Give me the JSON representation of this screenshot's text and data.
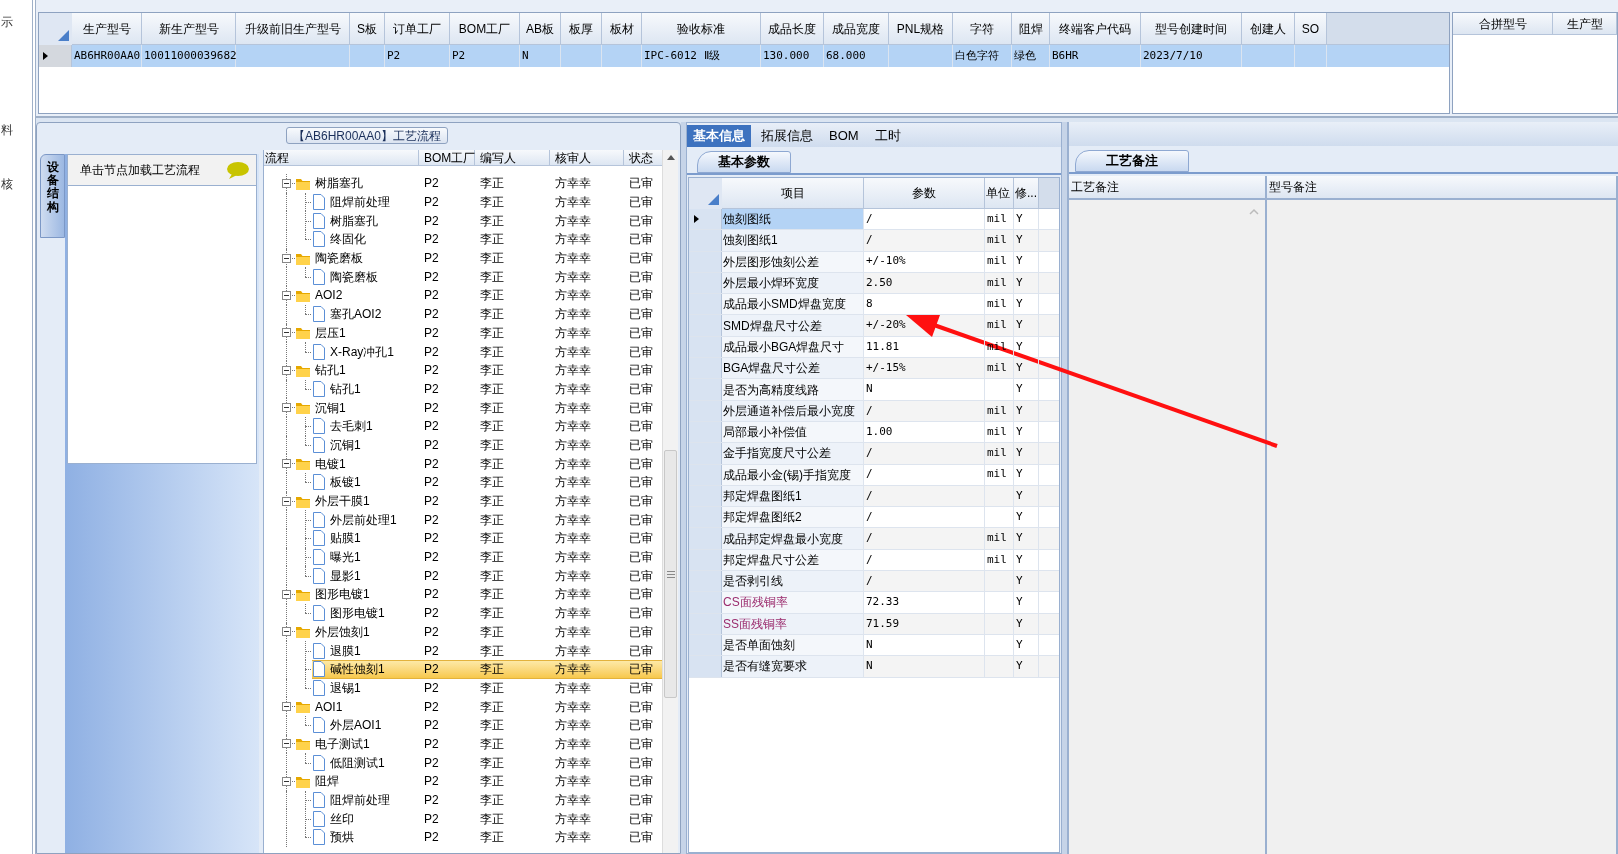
{
  "side_labels": [
    "示",
    "料",
    "核"
  ],
  "top_grid": {
    "columns": [
      "生产型号",
      "新生产型号",
      "升级前旧生产型号",
      "S板",
      "订单工厂",
      "BOM工厂",
      "AB板",
      "板厚",
      "板材",
      "验收标准",
      "成品长度",
      "成品宽度",
      "PNL规格",
      "字符",
      "阻焊",
      "终端客户代码",
      "型号创建时间",
      "创建人",
      "SO"
    ],
    "rows": [
      {
        "selected": true,
        "cells": [
          "AB6HR00AA0",
          "10011000039682",
          null,
          null,
          "P2",
          "P2",
          "N",
          null,
          null,
          "IPC-6012 Ⅱ级",
          "130.000",
          "68.000",
          null,
          "白色字符",
          "绿色",
          "B6HR",
          "2023/7/10",
          null,
          null
        ]
      }
    ]
  },
  "merge_grid": {
    "columns": [
      "合拼型号",
      "生产型"
    ]
  },
  "process_box": {
    "title": "【AB6HR00AA0】工艺流程",
    "side_tab": "设备结构",
    "hint": "单击节点加载工艺流程",
    "tree": {
      "columns": [
        "流程",
        "BOM工厂",
        "编写人",
        "核审人",
        "状态"
      ],
      "nodes": [
        {
          "label": "树脂塞孔",
          "bom": "P2",
          "writer": "李正",
          "reviewer": "方幸幸",
          "status": "已审",
          "expanded": true,
          "selected": false,
          "children": [
            {
              "label": "阻焊前处理",
              "bom": "P2",
              "writer": "李正",
              "reviewer": "方幸幸",
              "status": "已审",
              "selected": false
            },
            {
              "label": "树脂塞孔",
              "bom": "P2",
              "writer": "李正",
              "reviewer": "方幸幸",
              "status": "已审",
              "selected": false
            },
            {
              "label": "终固化",
              "bom": "P2",
              "writer": "李正",
              "reviewer": "方幸幸",
              "status": "已审",
              "selected": false
            }
          ]
        },
        {
          "label": "陶瓷磨板",
          "bom": "P2",
          "writer": "李正",
          "reviewer": "方幸幸",
          "status": "已审",
          "expanded": true,
          "selected": false,
          "children": [
            {
              "label": "陶瓷磨板",
              "bom": "P2",
              "writer": "李正",
              "reviewer": "方幸幸",
              "status": "已审",
              "selected": false
            }
          ]
        },
        {
          "label": "AOI2",
          "bom": "P2",
          "writer": "李正",
          "reviewer": "方幸幸",
          "status": "已审",
          "expanded": true,
          "selected": false,
          "children": [
            {
              "label": "塞孔AOI2",
              "bom": "P2",
              "writer": "李正",
              "reviewer": "方幸幸",
              "status": "已审",
              "selected": false
            }
          ]
        },
        {
          "label": "层压1",
          "bom": "P2",
          "writer": "李正",
          "reviewer": "方幸幸",
          "status": "已审",
          "expanded": true,
          "selected": false,
          "children": [
            {
              "label": "X-Ray冲孔1",
              "bom": "P2",
              "writer": "李正",
              "reviewer": "方幸幸",
              "status": "已审",
              "selected": false
            }
          ]
        },
        {
          "label": "钻孔1",
          "bom": "P2",
          "writer": "李正",
          "reviewer": "方幸幸",
          "status": "已审",
          "expanded": true,
          "selected": false,
          "children": [
            {
              "label": "钻孔1",
              "bom": "P2",
              "writer": "李正",
              "reviewer": "方幸幸",
              "status": "已审",
              "selected": false
            }
          ]
        },
        {
          "label": "沉铜1",
          "bom": "P2",
          "writer": "李正",
          "reviewer": "方幸幸",
          "status": "已审",
          "expanded": true,
          "selected": false,
          "children": [
            {
              "label": "去毛刺1",
              "bom": "P2",
              "writer": "李正",
              "reviewer": "方幸幸",
              "status": "已审",
              "selected": false
            },
            {
              "label": "沉铜1",
              "bom": "P2",
              "writer": "李正",
              "reviewer": "方幸幸",
              "status": "已审",
              "selected": false
            }
          ]
        },
        {
          "label": "电镀1",
          "bom": "P2",
          "writer": "李正",
          "reviewer": "方幸幸",
          "status": "已审",
          "expanded": true,
          "selected": false,
          "children": [
            {
              "label": "板镀1",
              "bom": "P2",
              "writer": "李正",
              "reviewer": "方幸幸",
              "status": "已审",
              "selected": false
            }
          ]
        },
        {
          "label": "外层干膜1",
          "bom": "P2",
          "writer": "李正",
          "reviewer": "方幸幸",
          "status": "已审",
          "expanded": true,
          "selected": false,
          "children": [
            {
              "label": "外层前处理1",
              "bom": "P2",
              "writer": "李正",
              "reviewer": "方幸幸",
              "status": "已审",
              "selected": false
            },
            {
              "label": "贴膜1",
              "bom": "P2",
              "writer": "李正",
              "reviewer": "方幸幸",
              "status": "已审",
              "selected": false
            },
            {
              "label": "曝光1",
              "bom": "P2",
              "writer": "李正",
              "reviewer": "方幸幸",
              "status": "已审",
              "selected": false
            },
            {
              "label": "显影1",
              "bom": "P2",
              "writer": "李正",
              "reviewer": "方幸幸",
              "status": "已审",
              "selected": false
            }
          ]
        },
        {
          "label": "图形电镀1",
          "bom": "P2",
          "writer": "李正",
          "reviewer": "方幸幸",
          "status": "已审",
          "expanded": true,
          "selected": false,
          "children": [
            {
              "label": "图形电镀1",
              "bom": "P2",
              "writer": "李正",
              "reviewer": "方幸幸",
              "status": "已审",
              "selected": false
            }
          ]
        },
        {
          "label": "外层蚀刻1",
          "bom": "P2",
          "writer": "李正",
          "reviewer": "方幸幸",
          "status": "已审",
          "expanded": true,
          "selected": false,
          "children": [
            {
              "label": "退膜1",
              "bom": "P2",
              "writer": "李正",
              "reviewer": "方幸幸",
              "status": "已审",
              "selected": false
            },
            {
              "label": "碱性蚀刻1",
              "bom": "P2",
              "writer": "李正",
              "reviewer": "方幸幸",
              "status": "已审",
              "selected": true
            },
            {
              "label": "退锡1",
              "bom": "P2",
              "writer": "李正",
              "reviewer": "方幸幸",
              "status": "已审",
              "selected": false
            }
          ]
        },
        {
          "label": "AOI1",
          "bom": "P2",
          "writer": "李正",
          "reviewer": "方幸幸",
          "status": "已审",
          "expanded": true,
          "selected": false,
          "children": [
            {
              "label": "外层AOI1",
              "bom": "P2",
              "writer": "李正",
              "reviewer": "方幸幸",
              "status": "已审",
              "selected": false
            }
          ]
        },
        {
          "label": "电子测试1",
          "bom": "P2",
          "writer": "李正",
          "reviewer": "方幸幸",
          "status": "已审",
          "expanded": true,
          "selected": false,
          "children": [
            {
              "label": "低阻测试1",
              "bom": "P2",
              "writer": "李正",
              "reviewer": "方幸幸",
              "status": "已审",
              "selected": false
            }
          ]
        },
        {
          "label": "阻焊",
          "bom": "P2",
          "writer": "李正",
          "reviewer": "方幸幸",
          "status": "已审",
          "expanded": true,
          "selected": false,
          "children": [
            {
              "label": "阻焊前处理",
              "bom": "P2",
              "writer": "李正",
              "reviewer": "方幸幸",
              "status": "已审",
              "selected": false
            },
            {
              "label": "丝印",
              "bom": "P2",
              "writer": "李正",
              "reviewer": "方幸幸",
              "status": "已审",
              "selected": false
            },
            {
              "label": "预烘",
              "bom": "P2",
              "writer": "李正",
              "reviewer": "方幸幸",
              "status": "已审",
              "selected": false
            }
          ]
        }
      ]
    }
  },
  "info_panel": {
    "tabs": [
      {
        "label": "基本信息",
        "selected": true
      },
      {
        "label": "拓展信息",
        "selected": false
      },
      {
        "label": "BOM",
        "selected": false
      },
      {
        "label": "工时",
        "selected": false
      }
    ],
    "subtab": "基本参数",
    "columns": [
      "项目",
      "参数",
      "单位",
      "修..."
    ],
    "rows": [
      {
        "item": "蚀刻图纸",
        "value": "/",
        "unit": "mil",
        "flag": "Y",
        "highlighted": false,
        "selected": true
      },
      {
        "item": "蚀刻图纸1",
        "value": "/",
        "unit": "mil",
        "flag": "Y",
        "highlighted": false,
        "selected": false
      },
      {
        "item": "外层图形蚀刻公差",
        "value": "+/-10%",
        "unit": "mil",
        "flag": "Y",
        "highlighted": false,
        "selected": false
      },
      {
        "item": "外层最小焊环宽度",
        "value": "2.50",
        "unit": "mil",
        "flag": "Y",
        "highlighted": false,
        "selected": false
      },
      {
        "item": "成品最小SMD焊盘宽度",
        "value": "8",
        "unit": "mil",
        "flag": "Y",
        "highlighted": false,
        "selected": false
      },
      {
        "item": "SMD焊盘尺寸公差",
        "value": "+/-20%",
        "unit": "mil",
        "flag": "Y",
        "highlighted": false,
        "selected": false
      },
      {
        "item": "成品最小BGA焊盘尺寸",
        "value": "11.81",
        "unit": "mil",
        "flag": "Y",
        "highlighted": false,
        "selected": false
      },
      {
        "item": "BGA焊盘尺寸公差",
        "value": "+/-15%",
        "unit": "mil",
        "flag": "Y",
        "highlighted": false,
        "selected": false
      },
      {
        "item": "是否为高精度线路",
        "value": "N",
        "flag": "Y",
        "highlighted": false,
        "selected": false
      },
      {
        "item": "外层通道补偿后最小宽度",
        "value": "/",
        "unit": "mil",
        "flag": "Y",
        "highlighted": false,
        "selected": false
      },
      {
        "item": "局部最小补偿值",
        "value": "1.00",
        "unit": "mil",
        "flag": "Y",
        "highlighted": false,
        "selected": false
      },
      {
        "item": "金手指宽度尺寸公差",
        "value": "/",
        "unit": "mil",
        "flag": "Y",
        "highlighted": false,
        "selected": false
      },
      {
        "item": "成品最小金(锡)手指宽度",
        "value": "/",
        "unit": "mil",
        "flag": "Y",
        "highlighted": false,
        "selected": false
      },
      {
        "item": "邦定焊盘图纸1",
        "value": "/",
        "flag": "Y",
        "highlighted": false,
        "selected": false
      },
      {
        "item": "邦定焊盘图纸2",
        "value": "/",
        "flag": "Y",
        "highlighted": false,
        "selected": false
      },
      {
        "item": "成品邦定焊盘最小宽度",
        "value": "/",
        "unit": "mil",
        "flag": "Y",
        "highlighted": false,
        "selected": false
      },
      {
        "item": "邦定焊盘尺寸公差",
        "value": "/",
        "unit": "mil",
        "flag": "Y",
        "highlighted": false,
        "selected": false
      },
      {
        "item": "是否剥引线",
        "value": "/",
        "flag": "Y",
        "highlighted": false,
        "selected": false
      },
      {
        "item": "CS面残铜率",
        "value": "72.33",
        "flag": "Y",
        "highlighted": true,
        "selected": false
      },
      {
        "item": "SS面残铜率",
        "value": "71.59",
        "flag": "Y",
        "highlighted": true,
        "selected": false
      },
      {
        "item": "是否单面蚀刻",
        "value": "N",
        "flag": "Y",
        "highlighted": false,
        "selected": false
      },
      {
        "item": "是否有缝宽要求",
        "value": "N",
        "flag": "Y",
        "highlighted": false,
        "selected": false
      }
    ]
  },
  "remarks_panel": {
    "tab": "工艺备注",
    "columns": [
      "工艺备注",
      "型号备注"
    ]
  }
}
